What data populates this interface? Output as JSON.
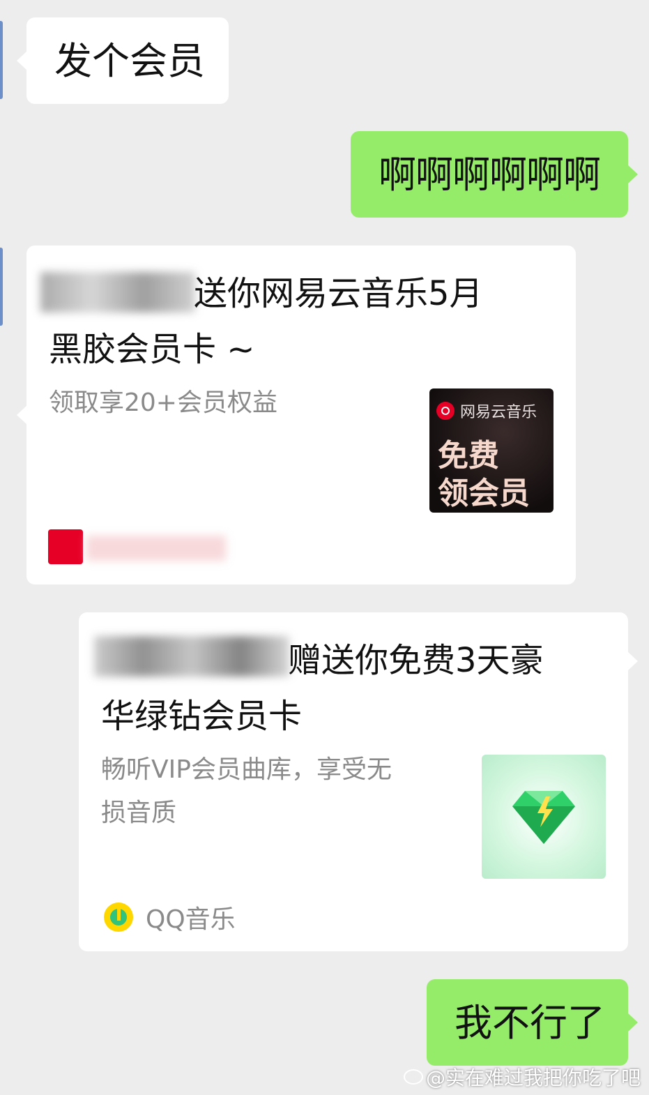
{
  "messages": {
    "m1": {
      "text": "发个会员"
    },
    "m2": {
      "text": "啊啊啊啊啊啊"
    },
    "card_netease": {
      "title_line1": "送你网易云音乐5月",
      "title_line2": "黑胶会员卡 ~",
      "description": "领取享20+会员权益",
      "thumb_brand": "网易云音乐",
      "thumb_line1": "免费",
      "thumb_line2": "领会员"
    },
    "card_qq": {
      "title_line1": "赠送你免费3天豪",
      "title_line2": "华绿钻会员卡",
      "description_line1": "畅听VIP会员曲库，享受无",
      "description_line2": "损音质",
      "source": "QQ音乐"
    },
    "m3": {
      "text": "我不行了"
    }
  },
  "watermark": {
    "text": "@实在难过我把你吃了吧"
  },
  "colors": {
    "background": "#ededed",
    "bubble_self": "#95ec69",
    "bubble_other": "#ffffff",
    "netease_red": "#e60026",
    "qq_green": "#31c27c",
    "qq_yellow": "#ffd700"
  },
  "icons": [
    "netease-music-logo-icon",
    "qq-music-logo-icon",
    "diamond-icon",
    "weibo-icon"
  ]
}
